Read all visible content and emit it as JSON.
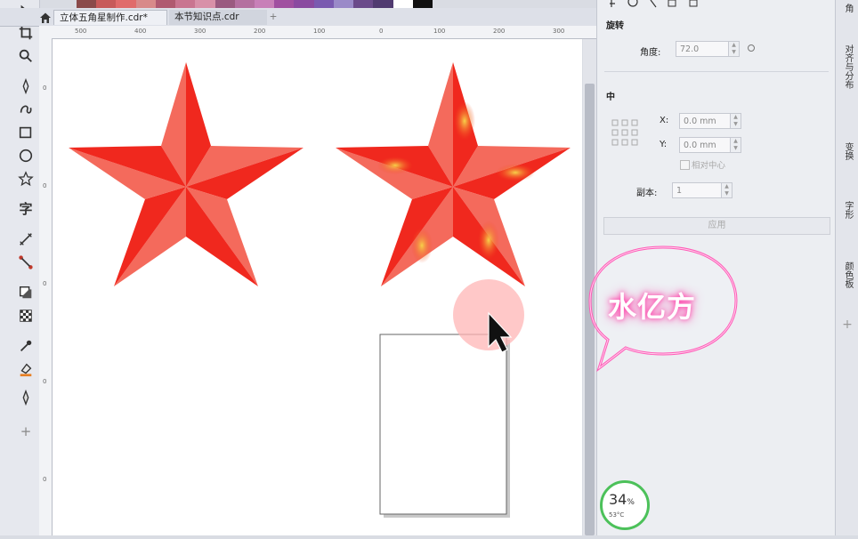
{
  "tabs": [
    {
      "label": "立体五角星制作.cdr*",
      "active": true
    },
    {
      "label": "本节知识点.cdr",
      "active": false
    }
  ],
  "tab_add": "+",
  "ruler": {
    "top_ticks": [
      "500",
      "400",
      "300",
      "200",
      "100",
      "0",
      "100",
      "200",
      "300"
    ],
    "left_ticks": [
      "0",
      "0",
      "0",
      "0",
      "0"
    ]
  },
  "toolbox": {
    "text_tool": "字",
    "add": "+"
  },
  "panel": {
    "rotate_title": "旋转",
    "angle_label": "角度:",
    "angle_value": "72.0",
    "center_title": "中",
    "x_label": "X:",
    "x_value": "0.0 mm",
    "y_label": "Y:",
    "y_value": "0.0 mm",
    "relative_center": "相对中心",
    "copies_label": "副本:",
    "copies_value": "1",
    "apply_label": "应用"
  },
  "dock": {
    "tab_corner": "角",
    "tab_align": "对齐与分布",
    "tab_transform": "变换",
    "tab_font": "字形",
    "tab_color": "颜色板",
    "add": "+"
  },
  "overlay": {
    "bubble_text": "水亿方",
    "gauge_percent": "34",
    "gauge_unit": "%",
    "gauge_temp": "53°C"
  },
  "colors": {
    "star_fill": "#f0281e",
    "star_light": "#f46a5c",
    "star_gold": "#f6c33a",
    "accent_pink": "#ff3da8",
    "gauge_green": "#4cc15a"
  }
}
